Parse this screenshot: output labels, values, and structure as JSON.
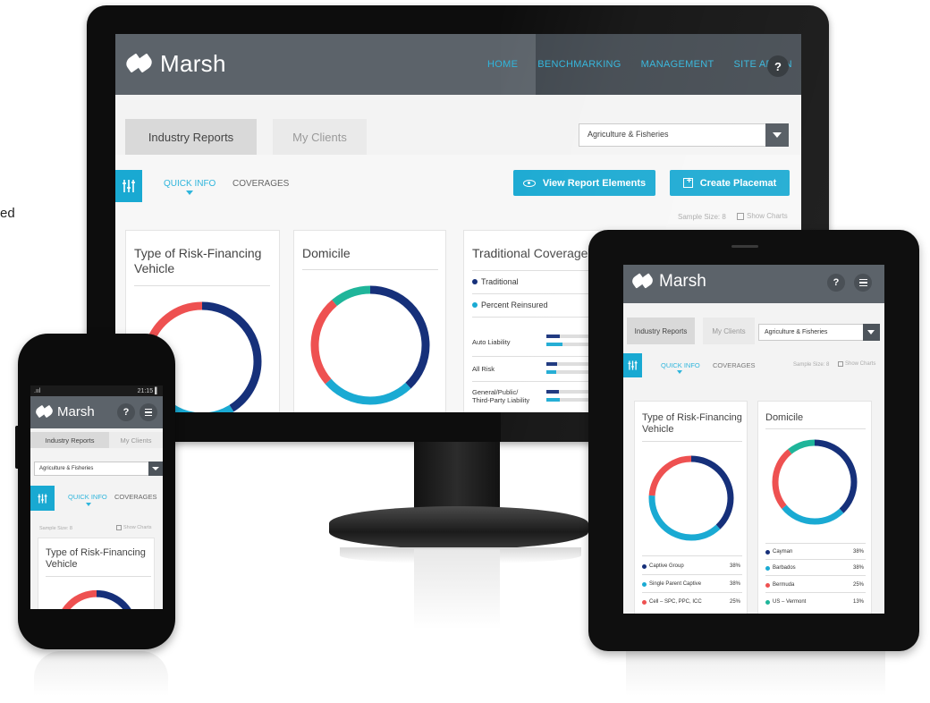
{
  "background_fragment": "ed",
  "brand": {
    "name": "Marsh",
    "accent": "#19a9d2",
    "nav_text": "#2fb5dc",
    "header_bg": "#5c636a"
  },
  "desktop": {
    "nav": {
      "home": "HOME",
      "benchmarking": "BENCHMARKING",
      "management": "MANAGEMENT",
      "site_admin": "SITE ADMIN",
      "help": "?"
    },
    "tabs": {
      "industry_reports": "Industry Reports",
      "my_clients": "My Clients"
    },
    "select": {
      "value": "Agriculture & Fisheries"
    },
    "subtabs": {
      "quick_info": "QUICK INFO",
      "coverages": "COVERAGES"
    },
    "buttons": {
      "view_report_elements": "View Report Elements",
      "create_placemat": "Create Placemat"
    },
    "sample_size": "Sample Size: 8",
    "show_charts": "Show Charts",
    "cards": {
      "risk_vehicle": {
        "title": "Type of Risk-Financing Vehicle"
      },
      "domicile": {
        "title": "Domicile"
      },
      "traditional": {
        "title": "Traditional Coverage",
        "legend": {
          "traditional": "Traditional",
          "percent_reinsured": "Percent Reinsured"
        },
        "rows": [
          {
            "label": "Auto Liability",
            "traditional": 0.27,
            "reinsured": 0.32
          },
          {
            "label": "All Risk",
            "traditional": 0.22,
            "reinsured": 0.2
          },
          {
            "label": "General/Public/ Third-Party Liability",
            "traditional": 0.25,
            "reinsured": 0.27
          }
        ]
      }
    }
  },
  "tablet": {
    "help": "?",
    "tabs": {
      "industry_reports": "Industry Reports",
      "my_clients": "My Clients"
    },
    "select": {
      "value": "Agriculture & Fisheries"
    },
    "subtabs": {
      "quick_info": "QUICK INFO",
      "coverages": "COVERAGES"
    },
    "sample_size": "Sample Size: 8",
    "show_charts": "Show Charts",
    "risk_vehicle": {
      "title": "Type of Risk-Financing Vehicle",
      "legend": [
        {
          "label": "Captive Group",
          "value": "38%",
          "color": "#16307a"
        },
        {
          "label": "Single Parent Captive",
          "value": "38%",
          "color": "#1aaad3"
        },
        {
          "label": "Cell – SPC, PPC, ICC",
          "value": "25%",
          "color": "#ee5151"
        }
      ]
    },
    "domicile": {
      "title": "Domicile",
      "legend": [
        {
          "label": "Cayman",
          "value": "38%",
          "color": "#16307a"
        },
        {
          "label": "Barbados",
          "value": "38%",
          "color": "#1aaad3"
        },
        {
          "label": "Bermuda",
          "value": "25%",
          "color": "#ee5151"
        },
        {
          "label": "US – Vermont",
          "value": "13%",
          "color": "#1fb59a"
        }
      ]
    }
  },
  "phone": {
    "status": {
      "signal": ".ııl",
      "time": "21:15 ▌"
    },
    "help": "?",
    "tabs": {
      "industry_reports": "Industry Reports",
      "my_clients": "My Clients"
    },
    "select": {
      "value": "Agriculture & Fisheries"
    },
    "subtabs": {
      "quick_info": "QUICK INFO",
      "coverages": "COVERAGES"
    },
    "sample_size": "Sample Size: 8",
    "show_charts": "Show Charts",
    "card_title": "Type of Risk-Financing Vehicle"
  }
}
